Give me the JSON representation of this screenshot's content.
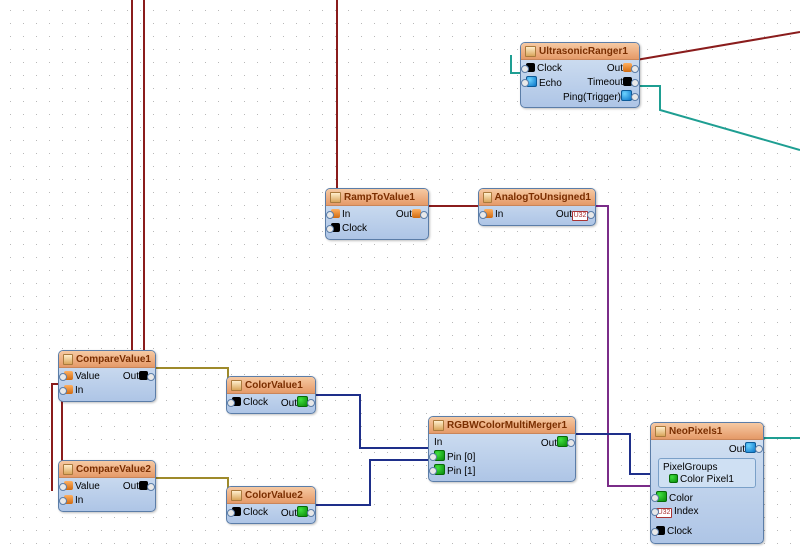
{
  "nodes": {
    "ultrasonic": {
      "title": "UltrasonicRanger1",
      "ports": {
        "clock": "Clock",
        "echo": "Echo",
        "out": "Out",
        "timeout": "Timeout",
        "ping": "Ping(Trigger)"
      }
    },
    "ramp": {
      "title": "RampToValue1",
      "ports": {
        "in": "In",
        "clock": "Clock",
        "out": "Out"
      }
    },
    "atou": {
      "title": "AnalogToUnsigned1",
      "ports": {
        "in": "In",
        "out": "Out",
        "outTag": "U32"
      }
    },
    "cmp1": {
      "title": "CompareValue1",
      "ports": {
        "value": "Value",
        "in": "In",
        "out": "Out"
      }
    },
    "cmp2": {
      "title": "CompareValue2",
      "ports": {
        "value": "Value",
        "in": "In",
        "out": "Out"
      }
    },
    "col1": {
      "title": "ColorValue1",
      "ports": {
        "clock": "Clock",
        "out": "Out"
      }
    },
    "col2": {
      "title": "ColorValue2",
      "ports": {
        "clock": "Clock",
        "out": "Out"
      }
    },
    "merger": {
      "title": "RGBWColorMultiMerger1",
      "ports": {
        "in": "In",
        "pin0": "Pin [0]",
        "pin1": "Pin [1]",
        "out": "Out"
      }
    },
    "neo": {
      "title": "NeoPixels1",
      "ports": {
        "out": "Out",
        "groupHeader": "PixelGroups",
        "groupItem": "Color Pixel1",
        "color": "Color",
        "index": "Index",
        "indexTag": "U32",
        "clock": "Clock"
      }
    }
  }
}
